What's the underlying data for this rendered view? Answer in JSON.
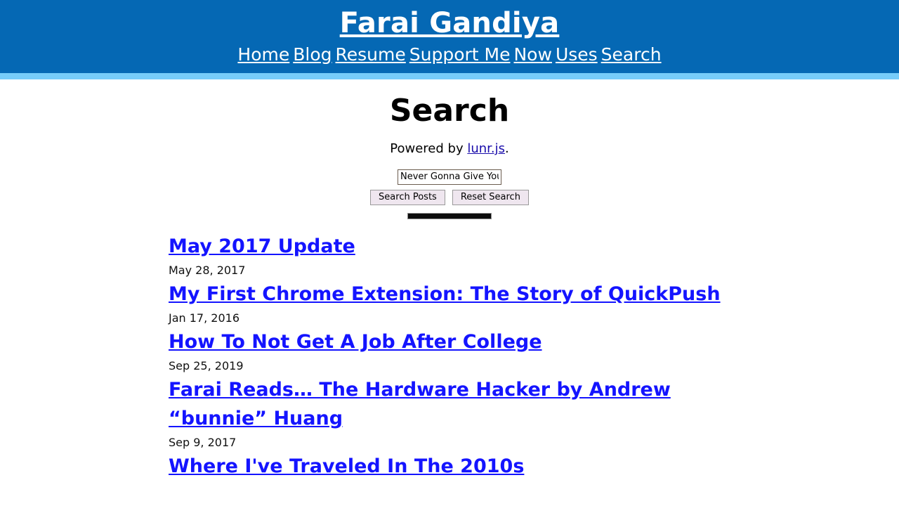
{
  "header": {
    "site_title": "Farai Gandiya",
    "nav_items": [
      {
        "label": "Home"
      },
      {
        "label": "Blog"
      },
      {
        "label": "Resume"
      },
      {
        "label": "Support Me"
      },
      {
        "label": "Now"
      },
      {
        "label": "Uses"
      },
      {
        "label": "Search"
      }
    ]
  },
  "main": {
    "page_title": "Search",
    "powered_by_prefix": "Powered by ",
    "powered_by_link": "lunr.js",
    "powered_by_suffix": ".",
    "search": {
      "value": "Never Gonna Give You Up",
      "placeholder": "",
      "submit_label": "Search Posts",
      "reset_label": "Reset Search"
    },
    "results": [
      {
        "title": "May 2017 Update",
        "date": "May 28, 2017"
      },
      {
        "title": "My First Chrome Extension: The Story of QuickPush",
        "date": "Jan 17, 2016"
      },
      {
        "title": "How To Not Get A Job After College",
        "date": "Sep 25, 2019"
      },
      {
        "title": "Farai Reads… The Hardware Hacker by Andrew “bunnie” Huang",
        "date": "Sep 9, 2017"
      },
      {
        "title": "Where I've Traveled In The 2010s",
        "date": ""
      }
    ]
  },
  "colors": {
    "header_bg": "#0568b4",
    "header_accent": "#77ccf9",
    "link": "#1414ff",
    "page_bg": "#ffffff"
  }
}
